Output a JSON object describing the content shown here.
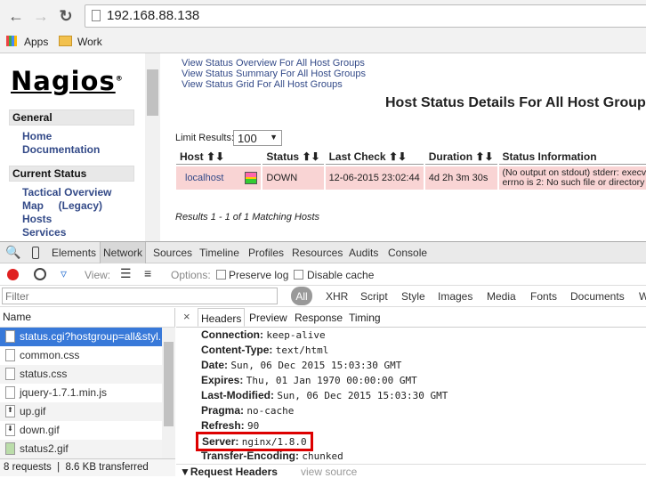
{
  "browser": {
    "url": "192.168.88.138",
    "bookmarks": [
      {
        "label": "Apps"
      },
      {
        "label": "Work"
      }
    ]
  },
  "sidebar": {
    "logo": "Nagios",
    "sections": [
      {
        "title": "General",
        "items": [
          "Home",
          "Documentation"
        ]
      },
      {
        "title": "Current Status",
        "items": [
          "Tactical Overview",
          "Map     (Legacy)",
          "Hosts",
          "Services"
        ]
      }
    ]
  },
  "main": {
    "links": [
      "View Status Overview For All Host Groups",
      "View Status Summary For All Host Groups",
      "View Status Grid For All Host Groups"
    ],
    "title": "Host Status Details For All Host Groups",
    "limit_label": "Limit Results:",
    "limit_value": "100",
    "columns": [
      "Host",
      "Status",
      "Last Check",
      "Duration",
      "Status Information"
    ],
    "rows": [
      {
        "host": "localhost",
        "status": "DOWN",
        "last_check": "12-06-2015 23:02:44",
        "duration": "4d 2h 3m 30s",
        "info1": "(No output on stdout) stderr: execvp",
        "info2": "errno is 2: No such file or directory"
      }
    ],
    "results": "Results 1 - 1 of 1 Matching Hosts",
    "row_color": "#f9d4d4"
  },
  "devtools": {
    "tabs": [
      "Elements",
      "Network",
      "Sources",
      "Timeline",
      "Profiles",
      "Resources",
      "Audits",
      "Console"
    ],
    "active_tab": "Network",
    "toolbar": {
      "view_label": "View:",
      "options_label": "Options:",
      "preserve_log": "Preserve log",
      "disable_cache": "Disable cache"
    },
    "filter_placeholder": "Filter",
    "types": [
      "All",
      "XHR",
      "Script",
      "Style",
      "Images",
      "Media",
      "Fonts",
      "Documents",
      "W"
    ],
    "name_header": "Name",
    "requests": [
      "status.cgi?hostgroup=all&styl...",
      "common.css",
      "status.css",
      "jquery-1.7.1.min.js",
      "up.gif",
      "down.gif",
      "status2.gif"
    ],
    "footer": "8 requests  |  8.6 KB transferred",
    "detail_tabs": [
      "Headers",
      "Preview",
      "Response",
      "Timing"
    ],
    "headers": [
      {
        "k": "Connection:",
        "v": "keep-alive"
      },
      {
        "k": "Content-Type:",
        "v": "text/html"
      },
      {
        "k": "Date:",
        "v": "Sun, 06 Dec 2015 15:03:30 GMT"
      },
      {
        "k": "Expires:",
        "v": "Thu, 01 Jan 1970 00:00:00 GMT"
      },
      {
        "k": "Last-Modified:",
        "v": "Sun, 06 Dec 2015 15:03:30 GMT"
      },
      {
        "k": "Pragma:",
        "v": "no-cache"
      },
      {
        "k": "Refresh:",
        "v": "90"
      },
      {
        "k": "Server:",
        "v": "nginx/1.8.0"
      },
      {
        "k": "Transfer-Encoding:",
        "v": "chunked"
      }
    ],
    "request_headers": "Request Headers",
    "view_source": "view source",
    "highlight_color": "#dd0000",
    "selected_color": "#3879d9"
  }
}
